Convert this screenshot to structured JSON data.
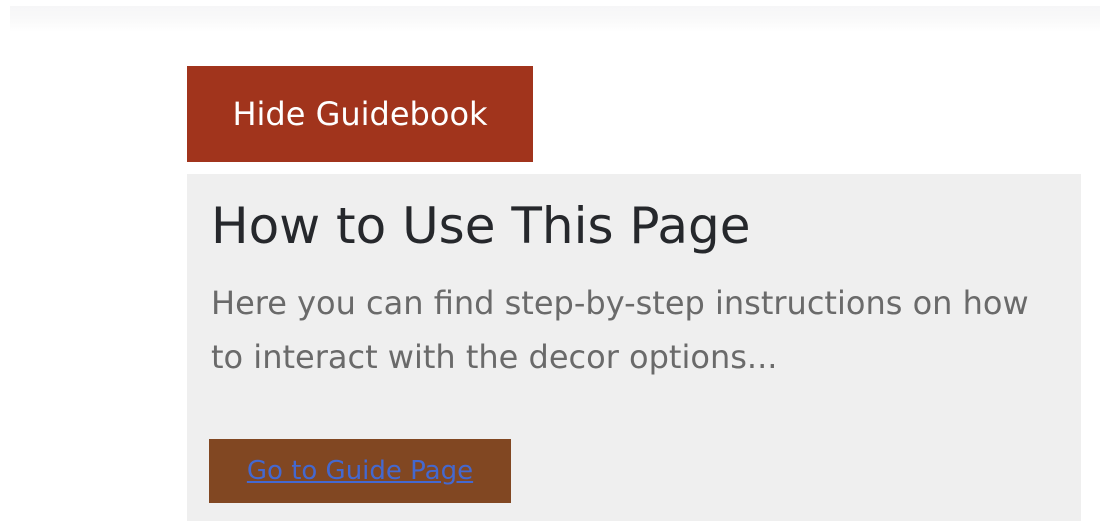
{
  "guidebook_toggle": {
    "label": "Hide Guidebook"
  },
  "guide": {
    "title": "How to Use This Page",
    "description": "Here you can find step-by-step instructions on how to interact with the decor options...",
    "link_label": "Go to Guide Page"
  },
  "colors": {
    "toggle_button_bg": "#a1341c",
    "panel_bg": "#efefef",
    "link_box_bg": "#814722",
    "link_text": "#4468cf"
  }
}
